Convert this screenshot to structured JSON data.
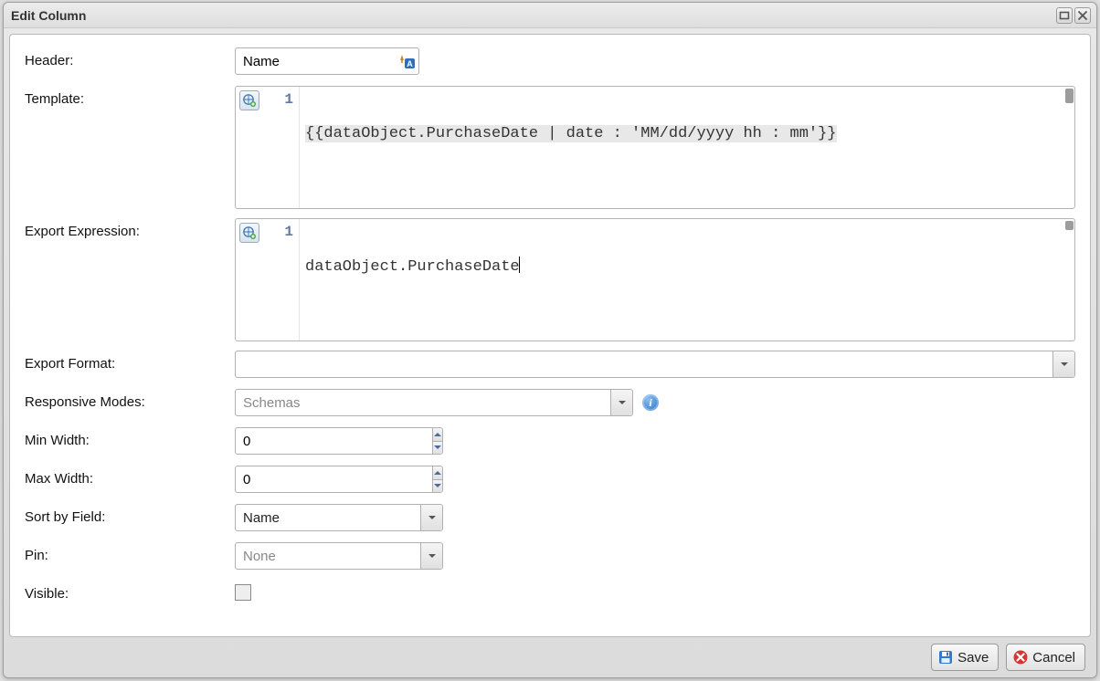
{
  "window": {
    "title": "Edit Column"
  },
  "labels": {
    "header": "Header:",
    "template": "Template:",
    "export_expression": "Export Expression:",
    "export_format": "Export Format:",
    "responsive_modes": "Responsive Modes:",
    "min_width": "Min Width:",
    "max_width": "Max Width:",
    "sort_by_field": "Sort by Field:",
    "pin": "Pin:",
    "visible": "Visible:"
  },
  "header": {
    "value": "Name"
  },
  "template": {
    "line_number": "1",
    "code": "{{dataObject.PurchaseDate | date : 'MM/dd/yyyy hh : mm'}}"
  },
  "export_expression": {
    "line_number": "1",
    "code": "dataObject.PurchaseDate"
  },
  "export_format": {
    "value": ""
  },
  "responsive_modes": {
    "placeholder": "Schemas"
  },
  "min_width": {
    "value": "0"
  },
  "max_width": {
    "value": "0"
  },
  "sort_by_field": {
    "value": "Name"
  },
  "pin": {
    "value": "None"
  },
  "visible": {
    "checked": false
  },
  "buttons": {
    "save": "Save",
    "cancel": "Cancel"
  }
}
